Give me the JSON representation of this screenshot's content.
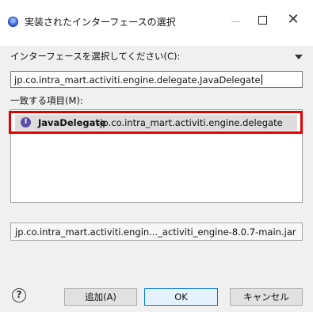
{
  "window": {
    "title": "実装されたインターフェースの選択",
    "close_glyph": "✕",
    "app_icon": "eclipse-icon"
  },
  "dialog": {
    "prompt_label": "インターフェースを選択してください(C):",
    "search_value": "jp.co.intra_mart.activiti.engine.delegate.JavaDelegate",
    "matches_label": "一致する項目(M):",
    "matches": [
      {
        "icon": "interface-icon",
        "icon_letter": "I",
        "name": "JavaDelegate",
        "package": "-jp.co.intra_mart.activiti.engine.delegate",
        "selected": true
      }
    ],
    "jar_path": "jp.co.intra_mart.activiti.engin..._activiti_engine-8.0.7-main.jar"
  },
  "buttons": {
    "help_glyph": "?",
    "add": "追加(A)",
    "ok": "OK",
    "cancel": "キャンセル"
  },
  "colors": {
    "highlight_border": "#e00000",
    "selection_bg": "#dcdcdc",
    "ok_border": "#0078d7"
  }
}
